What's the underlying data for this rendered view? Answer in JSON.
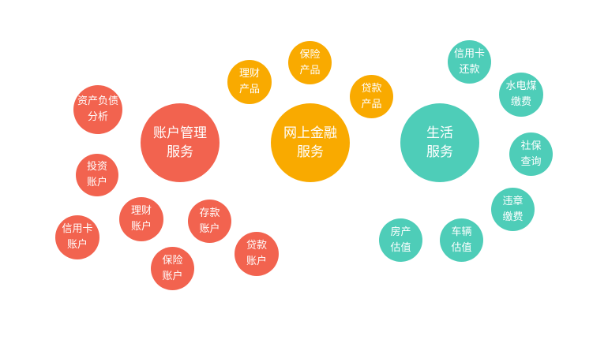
{
  "colors": {
    "account": "#f2634f",
    "finance": "#f9aa00",
    "life": "#4ecdb8"
  },
  "groups": {
    "account": {
      "hub": "账户管理\n服务",
      "items": [
        "资产负债\n分析",
        "投资\n账户",
        "信用卡\n账户",
        "理财\n账户",
        "存款\n账户",
        "保险\n账户",
        "贷款\n账户"
      ]
    },
    "finance": {
      "hub": "网上金融\n服务",
      "items": [
        "理财\n产品",
        "保险\n产品",
        "贷款\n产品"
      ]
    },
    "life": {
      "hub": "生活\n服务",
      "items": [
        "信用卡\n还款",
        "水电煤\n缴费",
        "社保\n查询",
        "违章\n缴费",
        "车辆\n估值",
        "房产\n估值"
      ]
    }
  }
}
